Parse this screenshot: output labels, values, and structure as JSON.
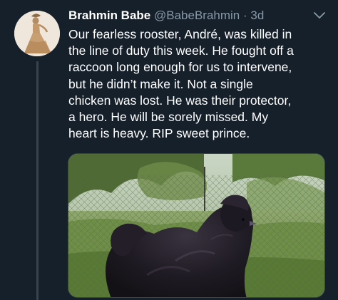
{
  "tweet": {
    "author": {
      "display_name": "Brahmin Babe",
      "handle": "@BabeBrahmin",
      "separator": "·",
      "age": "3d"
    },
    "text": "Our fearless rooster, André, was killed in\nthe line of duty this week. He fought off a\nraccoon long enough for us to intervene,\nbut he didn’t make it. Not a single\nchicken was lost. He was their protector,\na hero. He will be sorely missed. My\nheart is heavy. RIP sweet prince.",
    "media": {
      "description_icon": "photo-rooster"
    },
    "icons": {
      "menu": "chevron-down-icon"
    }
  },
  "colors": {
    "background": "#15202b",
    "primary_text": "#ffffff",
    "secondary_text": "#8899a6",
    "border": "#38444d"
  }
}
